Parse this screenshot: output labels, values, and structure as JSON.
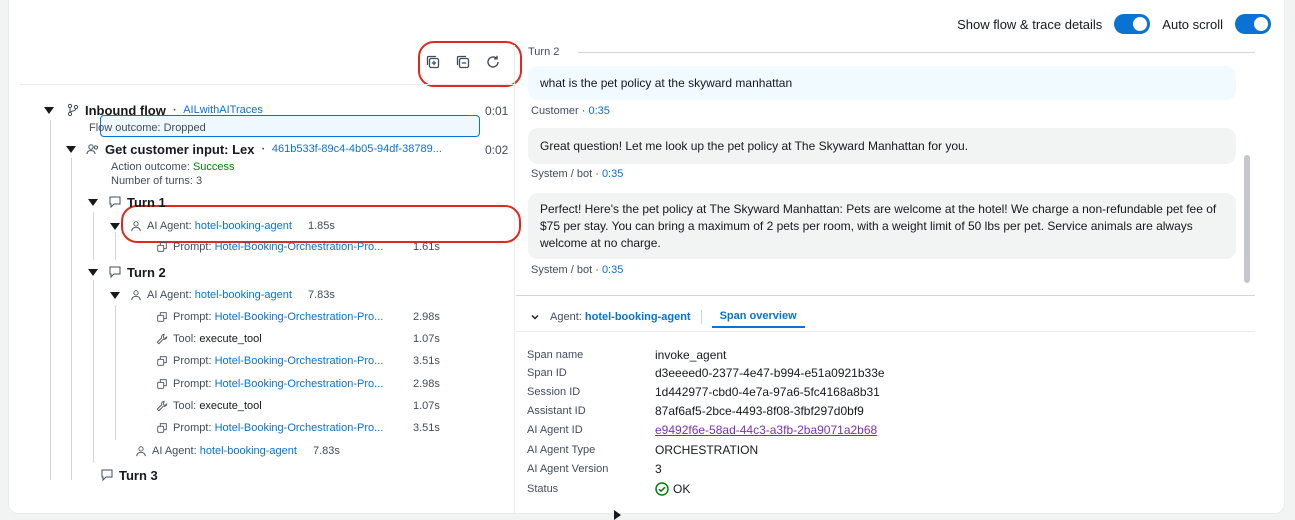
{
  "header": {
    "show_details_label": "Show flow & trace details",
    "auto_scroll_label": "Auto scroll"
  },
  "tree": {
    "inbound_flow": {
      "label": "Inbound flow",
      "flow_name": "AILwithAITraces",
      "time": "0:01",
      "outcome_label": "Flow outcome: Dropped"
    },
    "get_input": {
      "label": "Get customer input: Lex",
      "id": "461b533f-89c4-4b05-94df-38789...",
      "time": "0:02",
      "action_outcome_prefix": "Action outcome:",
      "action_outcome_value": "Success",
      "turns_label": "Number of turns: 3"
    },
    "turn1": {
      "label": "Turn 1",
      "agent": {
        "prefix": "AI Agent:",
        "name": "hotel-booking-agent",
        "duration": "1.85s"
      },
      "prompt": {
        "prefix": "Prompt:",
        "name": "Hotel-Booking-Orchestration-Pro...",
        "duration": "1.61s"
      }
    },
    "turn2": {
      "label": "Turn 2",
      "agent": {
        "prefix": "AI Agent:",
        "name": "hotel-booking-agent",
        "duration": "7.83s"
      },
      "children": [
        {
          "type": "prompt",
          "prefix": "Prompt:",
          "name": "Hotel-Booking-Orchestration-Pro...",
          "duration": "2.98s"
        },
        {
          "type": "tool",
          "prefix": "Tool:",
          "name": "execute_tool",
          "duration": "1.07s"
        },
        {
          "type": "prompt",
          "prefix": "Prompt:",
          "name": "Hotel-Booking-Orchestration-Pro...",
          "duration": "3.51s"
        },
        {
          "type": "prompt",
          "prefix": "Prompt:",
          "name": "Hotel-Booking-Orchestration-Pro...",
          "duration": "2.98s"
        },
        {
          "type": "tool",
          "prefix": "Tool:",
          "name": "execute_tool",
          "duration": "1.07s"
        },
        {
          "type": "prompt",
          "prefix": "Prompt:",
          "name": "Hotel-Booking-Orchestration-Pro...",
          "duration": "3.51s"
        }
      ],
      "agent2": {
        "prefix": "AI Agent:",
        "name": "hotel-booking-agent",
        "duration": "7.83s"
      }
    },
    "turn3": {
      "label": "Turn 3"
    }
  },
  "transcript": {
    "turn_label": "Turn 2",
    "messages": [
      {
        "text": "what is the pet policy at the skyward manhattan",
        "author": "Customer",
        "time": "0:35"
      },
      {
        "text": "Great question! Let me look up the pet policy at The Skyward Manhattan for you.",
        "author": "System / bot",
        "time": "0:35"
      },
      {
        "text": "Perfect! Here's the pet policy at The Skyward Manhattan: Pets are welcome at the hotel! We charge a non-refundable pet fee of $75 per stay. You can bring a maximum of 2 pets per room, with a weight limit of 50 lbs per pet. Service animals are always welcome at no charge.",
        "author": "System / bot",
        "time": "0:35"
      }
    ],
    "separator": "·"
  },
  "panel": {
    "agent_prefix": "Agent:",
    "agent_name": "hotel-booking-agent",
    "tab_label": "Span overview",
    "fields": [
      {
        "key": "Span name",
        "value": "invoke_agent"
      },
      {
        "key": "Span ID",
        "value": "d3eeeed0-2377-4e47-b994-e51a0921b33e"
      },
      {
        "key": "Session ID",
        "value": "1d442977-cbd0-4e7a-97a6-5fc4168a8b31"
      },
      {
        "key": "Assistant ID",
        "value": "87af6af5-2bce-4493-8f08-3fbf297d0bf9"
      },
      {
        "key": "AI Agent ID",
        "value": "e9492f6e-58ad-44c3-a3fb-2ba9071a2b68"
      },
      {
        "key": "AI Agent Type",
        "value": "ORCHESTRATION"
      },
      {
        "key": "AI Agent Version",
        "value": "3"
      },
      {
        "key": "Status",
        "value": "OK"
      }
    ]
  },
  "colors": {
    "accent": "#0972d3",
    "success": "#037f0c",
    "highlight": "#e0281d"
  }
}
